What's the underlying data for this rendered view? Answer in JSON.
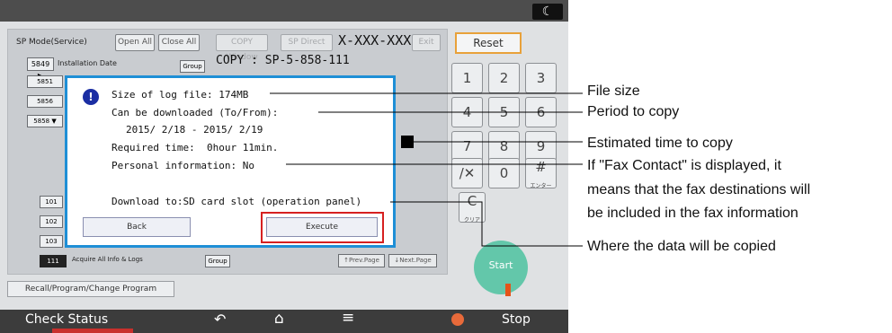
{
  "sp_header": {
    "mode_title": "SP Mode(Service)",
    "open_all": "Open All",
    "close_all": "Close All",
    "copy_window": "COPY Window",
    "sp_direct": "SP Direct",
    "code_field": "X-XXX-XXX",
    "exit": "Exit"
  },
  "sp_list": {
    "row1_code": "5849 ▶",
    "row1_label": "Installation Date",
    "group_label": "Group",
    "copy_ref": "COPY : SP-5-858-111",
    "stub_5851": "5851",
    "stub_5856": "5856",
    "stub_5858": "5858 ▼",
    "stub_101": "101",
    "stub_102": "102",
    "stub_103": "103",
    "acq_code": "111",
    "acq_label": "Acquire All Info & Logs",
    "prev_page": "↑Prev.Page",
    "next_page": "↓Next.Page"
  },
  "recall_button": "Recall/Program/Change Program",
  "keypad": {
    "reset": "Reset",
    "keys": [
      "1",
      "2",
      "3",
      "4",
      "5",
      "6",
      "7",
      "8",
      "9",
      "/✕",
      "0",
      "#"
    ],
    "hash_sub": "エンター",
    "clear": "C",
    "clear_sub": "クリア",
    "start": "Start"
  },
  "bottom_bar": {
    "check_status": "Check Status",
    "stop": "Stop"
  },
  "dialog": {
    "size": "Size of log file: 174MB",
    "period_label": "Can be downloaded (To/From):",
    "period_value": "2015/ 2/18 - 2015/ 2/19",
    "required_time": "Required time:  0hour 11min.",
    "personal_info": "Personal information: No",
    "download_to": "Download to:SD card slot (operation panel)",
    "back": "Back",
    "execute": "Execute"
  },
  "annotations": {
    "file_size": "File size",
    "period": "Period to copy",
    "estimated": "Estimated time to copy",
    "fax_line1": "If \"Fax Contact\" is displayed, it",
    "fax_line2": "means that the fax destinations will",
    "fax_line3": "be included in the fax information",
    "where": "Where the data will be copied"
  }
}
